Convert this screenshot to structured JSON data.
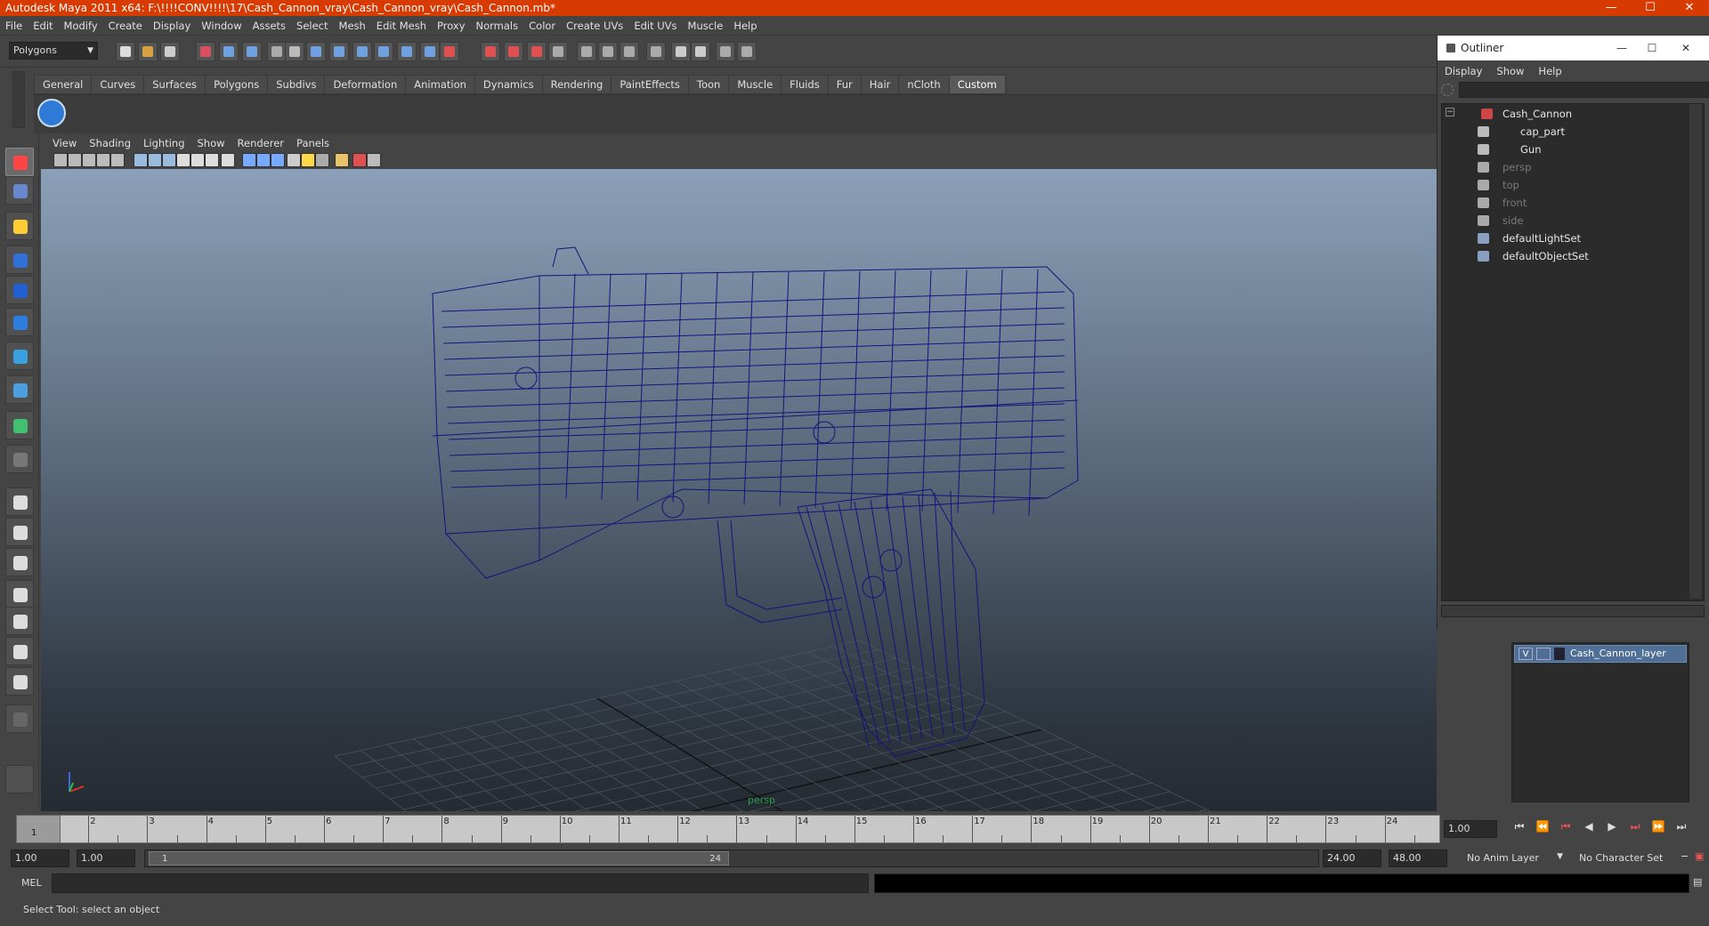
{
  "window": {
    "title": "Autodesk Maya 2011 x64: F:\\!!!!CONV!!!!\\17\\Cash_Cannon_vray\\Cash_Cannon_vray\\Cash_Cannon.mb*",
    "minimize_icon": "minimize-icon",
    "maximize_icon": "maximize-icon",
    "close_icon": "close-icon",
    "accent": "#d83b01"
  },
  "menubar": {
    "items": [
      "File",
      "Edit",
      "Modify",
      "Create",
      "Display",
      "Window",
      "Assets",
      "Select",
      "Mesh",
      "Edit Mesh",
      "Proxy",
      "Normals",
      "Color",
      "Create UVs",
      "Edit UVs",
      "Muscle",
      "Help"
    ]
  },
  "statusline": {
    "mode": "Polygons"
  },
  "shelf": {
    "tabs": [
      "General",
      "Curves",
      "Surfaces",
      "Polygons",
      "Subdivs",
      "Deformation",
      "Animation",
      "Dynamics",
      "Rendering",
      "PaintEffects",
      "Toon",
      "Muscle",
      "Fluids",
      "Fur",
      "Hair",
      "nCloth",
      "Custom"
    ],
    "active_tab": "Custom"
  },
  "panel": {
    "menu": [
      "View",
      "Shading",
      "Lighting",
      "Show",
      "Renderer",
      "Panels"
    ],
    "camera_label": "persp"
  },
  "outliner": {
    "title": "Outliner",
    "menu": [
      "Display",
      "Show",
      "Help"
    ],
    "items": [
      {
        "label": "Cash_Cannon",
        "depth": 0,
        "dim": false,
        "icon": "transform-icon"
      },
      {
        "label": "cap_part",
        "depth": 1,
        "dim": false,
        "icon": "mesh-icon"
      },
      {
        "label": "Gun",
        "depth": 1,
        "dim": false,
        "icon": "mesh-icon"
      },
      {
        "label": "persp",
        "depth": 0,
        "dim": true,
        "icon": "camera-icon"
      },
      {
        "label": "top",
        "depth": 0,
        "dim": true,
        "icon": "camera-icon"
      },
      {
        "label": "front",
        "depth": 0,
        "dim": true,
        "icon": "camera-icon"
      },
      {
        "label": "side",
        "depth": 0,
        "dim": true,
        "icon": "camera-icon"
      },
      {
        "label": "defaultLightSet",
        "depth": 0,
        "dim": false,
        "icon": "set-icon"
      },
      {
        "label": "defaultObjectSet",
        "depth": 0,
        "dim": false,
        "icon": "set-icon"
      }
    ]
  },
  "layers": {
    "visible_flag": "V",
    "name": "Cash_Cannon_layer"
  },
  "timeline": {
    "ticks": [
      "1",
      "2",
      "3",
      "4",
      "5",
      "6",
      "7",
      "8",
      "9",
      "10",
      "11",
      "12",
      "13",
      "14",
      "15",
      "16",
      "17",
      "18",
      "19",
      "20",
      "21",
      "22",
      "23",
      "24"
    ],
    "current_frame": "1",
    "current_time_field": "1.00"
  },
  "range": {
    "start_time": "1.00",
    "playback_start": "1.00",
    "slider_start": "1",
    "slider_end": "24",
    "playback_end": "24.00",
    "end_time": "48.00",
    "anim_layer": "No Anim Layer",
    "character_set": "No Character Set"
  },
  "command": {
    "language": "MEL"
  },
  "help_line": {
    "text": "Select Tool: select an object"
  }
}
